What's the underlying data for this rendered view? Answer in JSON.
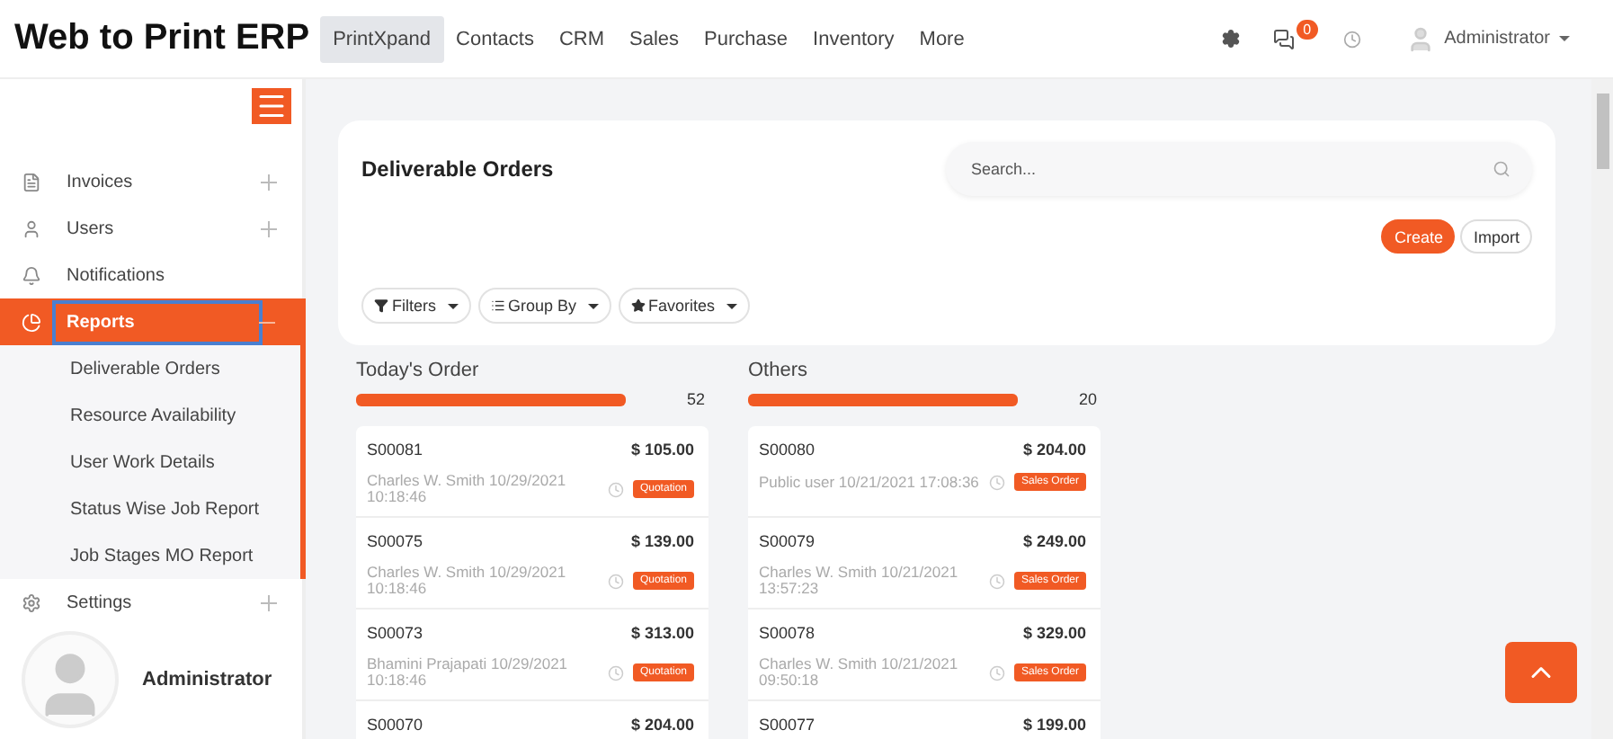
{
  "app": {
    "title": "Web to Print ERP"
  },
  "nav": [
    {
      "label": "PrintXpand",
      "selected": true
    },
    {
      "label": "Contacts",
      "selected": false
    },
    {
      "label": "CRM",
      "selected": false
    },
    {
      "label": "Sales",
      "selected": false
    },
    {
      "label": "Purchase",
      "selected": false
    },
    {
      "label": "Inventory",
      "selected": false
    },
    {
      "label": "More",
      "selected": false
    }
  ],
  "topbar": {
    "message_count": "0",
    "user": "Administrator"
  },
  "sidebar": {
    "items": [
      {
        "label": "Invoices",
        "kind": "group",
        "expanded": false,
        "selected": false
      },
      {
        "label": "Users",
        "kind": "group",
        "expanded": false,
        "selected": false
      },
      {
        "label": "Notifications",
        "kind": "link",
        "expanded": false,
        "selected": false
      },
      {
        "label": "Reports",
        "kind": "group",
        "expanded": true,
        "selected": true,
        "children": [
          {
            "label": "Deliverable Orders"
          },
          {
            "label": "Resource Availability"
          },
          {
            "label": "User Work Details"
          },
          {
            "label": "Status Wise Job Report"
          },
          {
            "label": "Job Stages MO Report"
          }
        ]
      },
      {
        "label": "Settings",
        "kind": "group",
        "expanded": false,
        "selected": false
      }
    ],
    "user": "Administrator"
  },
  "page": {
    "title": "Deliverable Orders",
    "search": {
      "placeholder": "Search..."
    },
    "buttons": [
      {
        "label": "Create",
        "kind": "primary"
      },
      {
        "label": "Import",
        "kind": "secondary"
      }
    ],
    "filters": [
      {
        "label": "Filters"
      },
      {
        "label": "Group By"
      },
      {
        "label": "Favorites"
      }
    ]
  },
  "columns": [
    {
      "title": "Today's Order",
      "count": "52",
      "level": 1,
      "cards": [
        {
          "number": "S00081",
          "amount": "$ 105.00",
          "customer": "Charles W. Smith 10/29/2021 10:18:46",
          "status": "Quotation"
        },
        {
          "number": "S00075",
          "amount": "$ 139.00",
          "customer": "Charles W. Smith 10/29/2021 10:18:46",
          "status": "Quotation"
        },
        {
          "number": "S00073",
          "amount": "$ 313.00",
          "customer": "Bhamini Prajapati 10/29/2021 10:18:46",
          "status": "Quotation"
        },
        {
          "number": "S00070",
          "amount": "$ 204.00"
        }
      ]
    },
    {
      "title": "Others",
      "count": "20",
      "level": 1,
      "cards": [
        {
          "number": "S00080",
          "amount": "$ 204.00",
          "customer": "Public user 10/21/2021 17:08:36",
          "status": "Sales Order"
        },
        {
          "number": "S00079",
          "amount": "$ 249.00",
          "customer": "Charles W. Smith 10/21/2021 13:57:23",
          "status": "Sales Order"
        },
        {
          "number": "S00078",
          "amount": "$ 329.00",
          "customer": "Charles W. Smith 10/21/2021 09:50:18",
          "status": "Sales Order"
        },
        {
          "number": "S00077",
          "amount": "$ 199.00"
        }
      ]
    }
  ]
}
